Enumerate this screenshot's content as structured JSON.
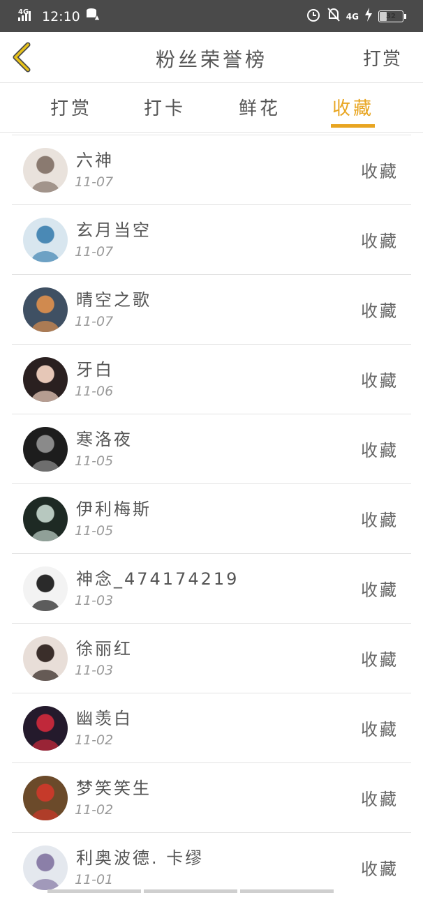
{
  "status": {
    "network_left": "4G",
    "time": "12:10",
    "network_right": "4G",
    "battery": "32"
  },
  "header": {
    "title": "粉丝荣誉榜",
    "action": "打赏"
  },
  "tabs": [
    {
      "label": "打赏"
    },
    {
      "label": "打卡"
    },
    {
      "label": "鲜花"
    },
    {
      "label": "收藏"
    }
  ],
  "active_tab": "收藏",
  "colors": {
    "accent": "#e8a521"
  },
  "fans": [
    {
      "name": "六神",
      "date": "11-07",
      "action": "收藏",
      "avatar": "pale",
      "avatar_colors": [
        "#e9e2dc",
        "#8a7a70"
      ]
    },
    {
      "name": "玄月当空",
      "date": "11-07",
      "action": "收藏",
      "avatar": "crystal",
      "avatar_colors": [
        "#d8e6ef",
        "#4a89b5"
      ]
    },
    {
      "name": "晴空之歌",
      "date": "11-07",
      "action": "收藏",
      "avatar": "sky",
      "avatar_colors": [
        "#3f5063",
        "#d08a4f"
      ]
    },
    {
      "name": "牙白",
      "date": "11-06",
      "action": "收藏",
      "avatar": "portrait",
      "avatar_colors": [
        "#2a2020",
        "#e6c7b7"
      ]
    },
    {
      "name": "寒洛夜",
      "date": "11-05",
      "action": "收藏",
      "avatar": "dark",
      "avatar_colors": [
        "#1d1d1d",
        "#8a8a8a"
      ]
    },
    {
      "name": "伊利梅斯",
      "date": "11-05",
      "action": "收藏",
      "avatar": "green",
      "avatar_colors": [
        "#1e2a24",
        "#b7c8bf"
      ]
    },
    {
      "name": "神念_474174219",
      "date": "11-03",
      "action": "收藏",
      "avatar": "sketch",
      "avatar_colors": [
        "#f3f3f3",
        "#2a2a2a"
      ]
    },
    {
      "name": "徐丽红",
      "date": "11-03",
      "action": "收藏",
      "avatar": "face",
      "avatar_colors": [
        "#e8ded8",
        "#3a2e2a"
      ]
    },
    {
      "name": "幽羡白",
      "date": "11-02",
      "action": "收藏",
      "avatar": "night",
      "avatar_colors": [
        "#241a2c",
        "#c0283a"
      ]
    },
    {
      "name": "梦笑笑生",
      "date": "11-02",
      "action": "收藏",
      "avatar": "luffy",
      "avatar_colors": [
        "#6b4a2a",
        "#c63a2a"
      ]
    },
    {
      "name": "利奥波德. 卡缪",
      "date": "11-01",
      "action": "收藏",
      "avatar": "silver",
      "avatar_colors": [
        "#e4e8ee",
        "#8b7fa8"
      ]
    }
  ]
}
